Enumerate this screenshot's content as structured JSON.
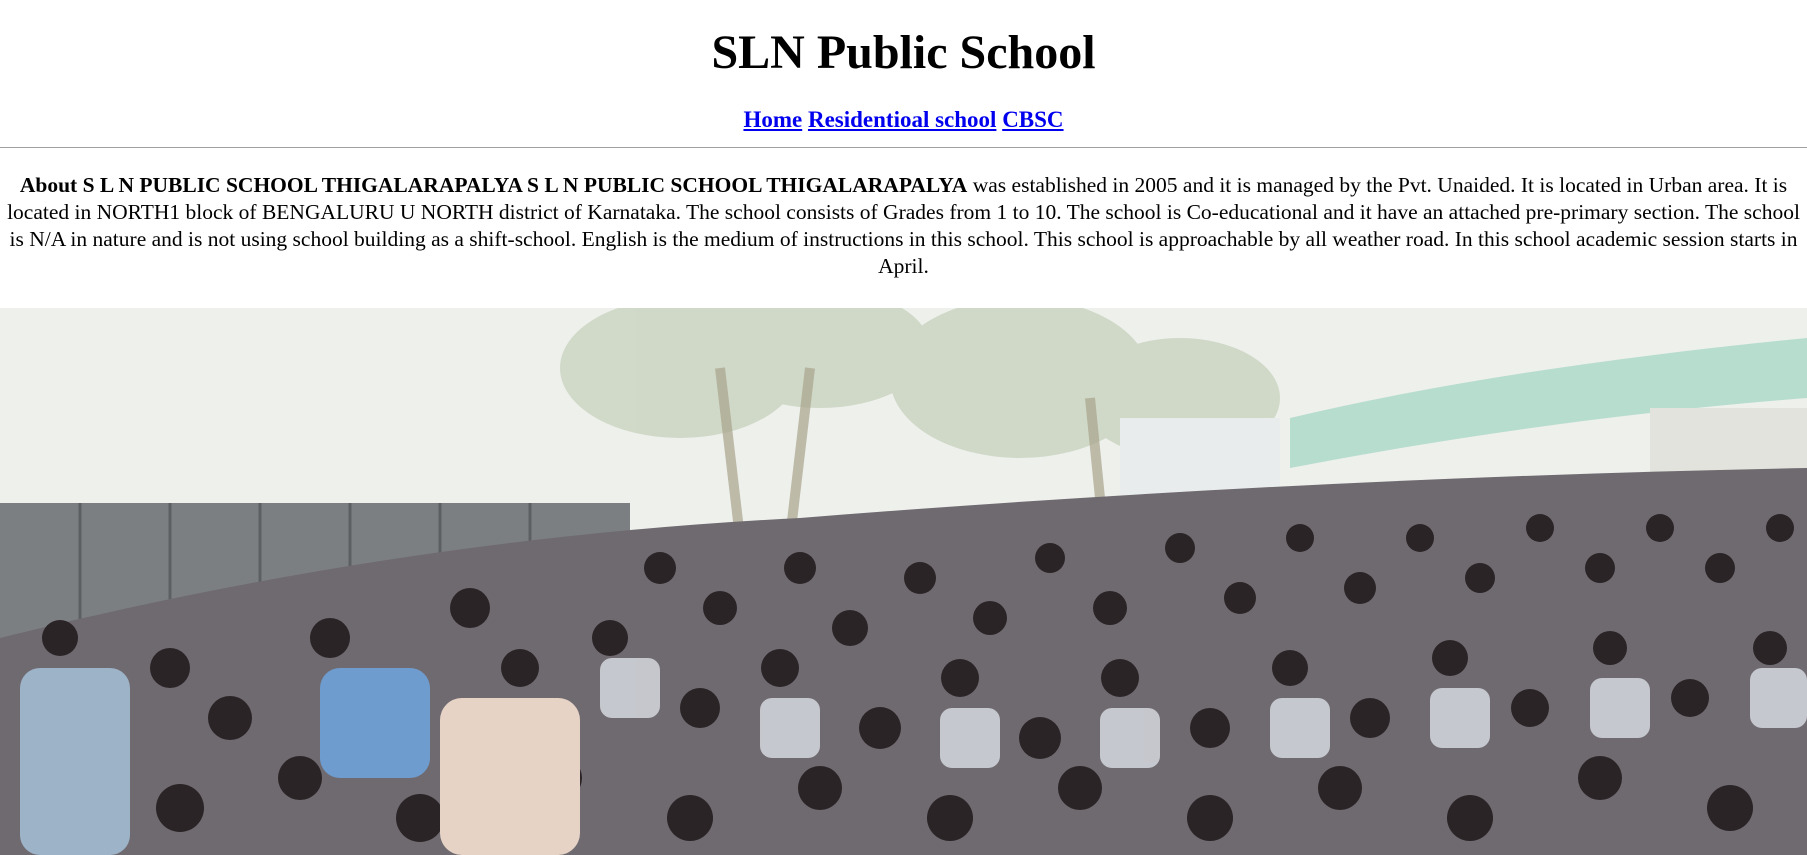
{
  "header": {
    "title": "SLN Public School"
  },
  "nav": {
    "links": [
      {
        "label": "Home"
      },
      {
        "label": "Residentioal school"
      },
      {
        "label": "CBSC"
      }
    ]
  },
  "about": {
    "bold_text": "About S L N PUBLIC SCHOOL THIGALARAPALYA S L N PUBLIC SCHOOL THIGALARAPALYA",
    "body_text": " was established in 2005 and it is managed by the Pvt. Unaided. It is located in Urban area. It is located in NORTH1 block of BENGALURU U NORTH district of Karnataka. The school consists of Grades from 1 to 10. The school is Co-educational and it have an attached pre-primary section. The school is N/A in nature and is not using school building as a shift-school. English is the medium of instructions in this school. This school is approachable by all weather road. In this school academic session starts in April."
  },
  "colors": {
    "link": "#0000ee",
    "rule": "#a0a0a0"
  }
}
